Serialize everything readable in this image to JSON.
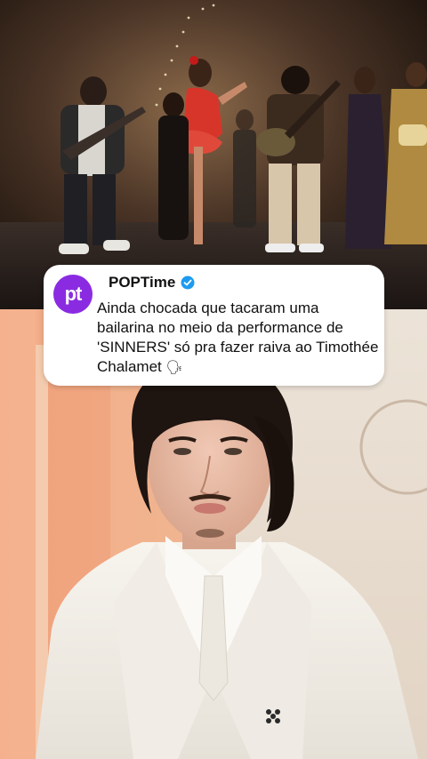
{
  "post": {
    "avatar_text": "pt",
    "author": "POPTime",
    "verified_icon": "verified-badge-icon",
    "text": "Ainda chocada que tacaram uma bailarina no meio da performance de 'SINNERS' só pra fazer raiva ao Timothée Chalamet",
    "emoji": "🗣"
  },
  "colors": {
    "avatar_bg": "#8a2be2",
    "verified": "#1d9bf0",
    "card_bg": "#ffffff"
  }
}
